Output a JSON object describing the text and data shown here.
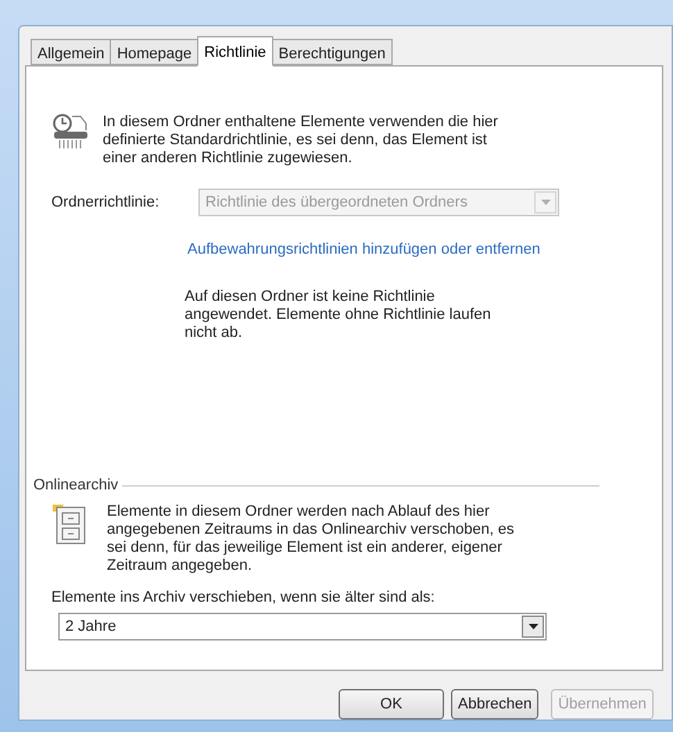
{
  "tabs": [
    {
      "label": "Allgemein",
      "selected": false
    },
    {
      "label": "Homepage",
      "selected": false
    },
    {
      "label": "Richtlinie",
      "selected": true
    },
    {
      "label": "Berechtigungen",
      "selected": false
    }
  ],
  "policy": {
    "description": "In diesem Ordner enthaltene Elemente verwenden die hier definierte Standardrichtlinie, es sei denn, das Element ist einer anderen Richtlinie zugewiesen.",
    "label": "Ordnerrichtlinie:",
    "dropdown": {
      "value": "Richtlinie des übergeordneten Ordners",
      "disabled": true
    },
    "link": "Aufbewahrungsrichtlinien hinzufügen oder entfernen",
    "status": "Auf diesen Ordner ist keine Richtlinie angewendet. Elemente ohne Richtlinie laufen nicht ab."
  },
  "online_archive": {
    "title": "Onlinearchiv",
    "description": "Elemente in diesem Ordner werden nach Ablauf des hier angegebenen Zeitraums in das Onlinearchiv verschoben, es sei denn, für das jeweilige Element ist ein anderer, eigener Zeitraum angegeben.",
    "label": "Elemente ins Archiv verschieben, wenn sie älter sind als:",
    "dropdown": {
      "value": "2 Jahre",
      "disabled": false
    }
  },
  "buttons": [
    {
      "label": "OK",
      "disabled": false
    },
    {
      "label": "Abbrechen",
      "disabled": false
    },
    {
      "label": "Übernehmen",
      "disabled": true
    }
  ]
}
